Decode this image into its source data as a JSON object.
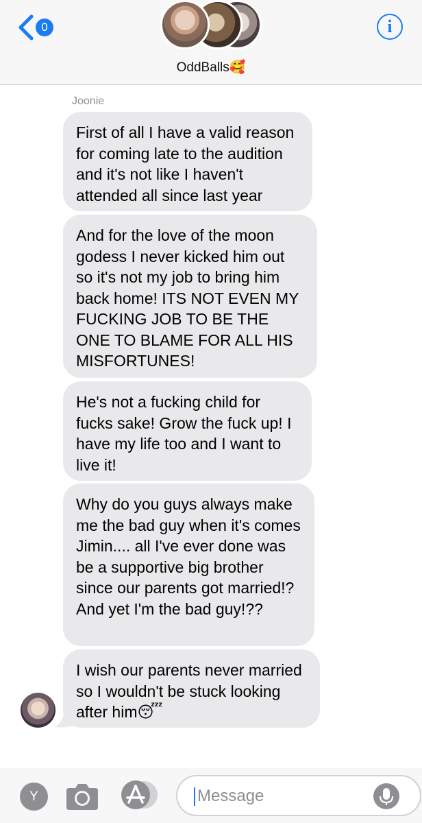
{
  "header": {
    "back_count": "0",
    "group_name": "OddBalls🥰",
    "info_label": "i"
  },
  "messages": [
    {
      "sender": "Joonie"
    },
    {
      "text": "First of all I have a valid reason for coming late to the audition and it's not like I haven't attended all since last year"
    },
    {
      "text": "And for the love of the moon godess I never kicked him out so it's not my job to bring him back home! ITS NOT EVEN MY FUCKING JOB TO BE THE ONE TO BLAME FOR ALL HIS MISFORTUNES!"
    },
    {
      "text": "He's not a fucking child for fucks sake! Grow the fuck up! I have my life too and I want to live it!"
    },
    {
      "text": "Why do you guys always make me the bad guy when it's comes Jimin....  all I've ever done was be a supportive big brother since our parents got married!? And yet I'm the bad guy!??"
    },
    {
      "text": "I wish our parents never married so I wouldn't be stuck looking after him😴"
    }
  ],
  "composer": {
    "y_label": "Y",
    "placeholder": "Message",
    "value": ""
  },
  "icons": {
    "back": "chevron-left-icon",
    "info": "info-icon",
    "camera": "camera-icon",
    "apps": "app-store-icon",
    "mic": "microphone-icon"
  },
  "colors": {
    "accent": "#1a7cf5",
    "bubble": "#e9e9eb",
    "header_bg": "#f7f7f7",
    "secondary_text": "#8e8e93"
  }
}
